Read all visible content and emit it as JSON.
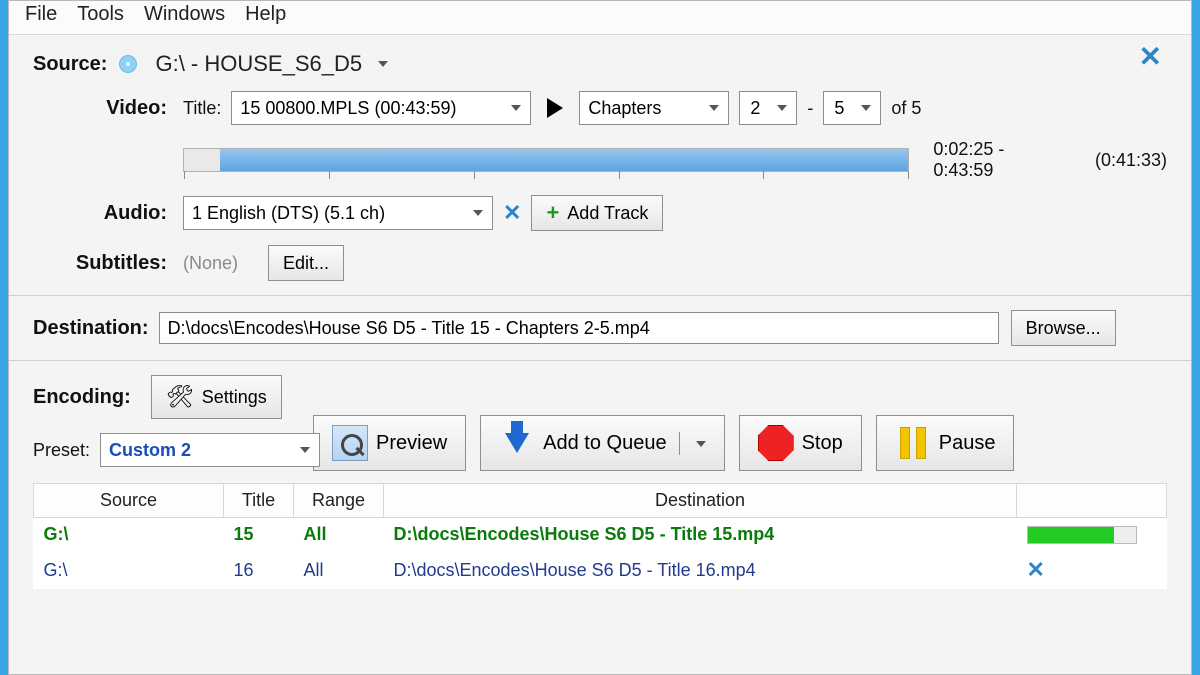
{
  "menu": {
    "file": "File",
    "tools": "Tools",
    "windows": "Windows",
    "help": "Help"
  },
  "source": {
    "label": "Source:",
    "path": "G:\\ - HOUSE_S6_D5"
  },
  "video": {
    "label": "Video:",
    "title_label": "Title:",
    "title_value": "15 00800.MPLS (00:43:59)",
    "range_mode": "Chapters",
    "range_from": "2",
    "range_dash": "-",
    "range_to": "5",
    "of_label": "of 5",
    "timeline": {
      "start_pct": 5,
      "end_pct": 100
    },
    "time_range": "0:02:25 - 0:43:59",
    "duration": "(0:41:33)"
  },
  "audio": {
    "label": "Audio:",
    "track": "1 English (DTS) (5.1 ch)",
    "add_label": "Add Track"
  },
  "subtitles": {
    "label": "Subtitles:",
    "value": "(None)",
    "edit": "Edit..."
  },
  "destination": {
    "label": "Destination:",
    "value": "D:\\docs\\Encodes\\House S6 D5 - Title 15 - Chapters 2-5.mp4",
    "browse": "Browse..."
  },
  "encoding": {
    "label": "Encoding:",
    "settings": "Settings",
    "preset_label": "Preset:",
    "preset_value": "Custom 2",
    "preview": "Preview",
    "add_queue": "Add to Queue",
    "stop": "Stop",
    "pause": "Pause"
  },
  "queue": {
    "headers": {
      "source": "Source",
      "title": "Title",
      "range": "Range",
      "destination": "Destination"
    },
    "rows": [
      {
        "source": "G:\\",
        "title": "15",
        "range": "All",
        "destination": "D:\\docs\\Encodes\\House S6 D5 - Title 15.mp4",
        "progress": 80,
        "status": "running"
      },
      {
        "source": "G:\\",
        "title": "16",
        "range": "All",
        "destination": "D:\\docs\\Encodes\\House S6 D5 - Title 16.mp4",
        "progress": 0,
        "status": "queued"
      }
    ]
  }
}
